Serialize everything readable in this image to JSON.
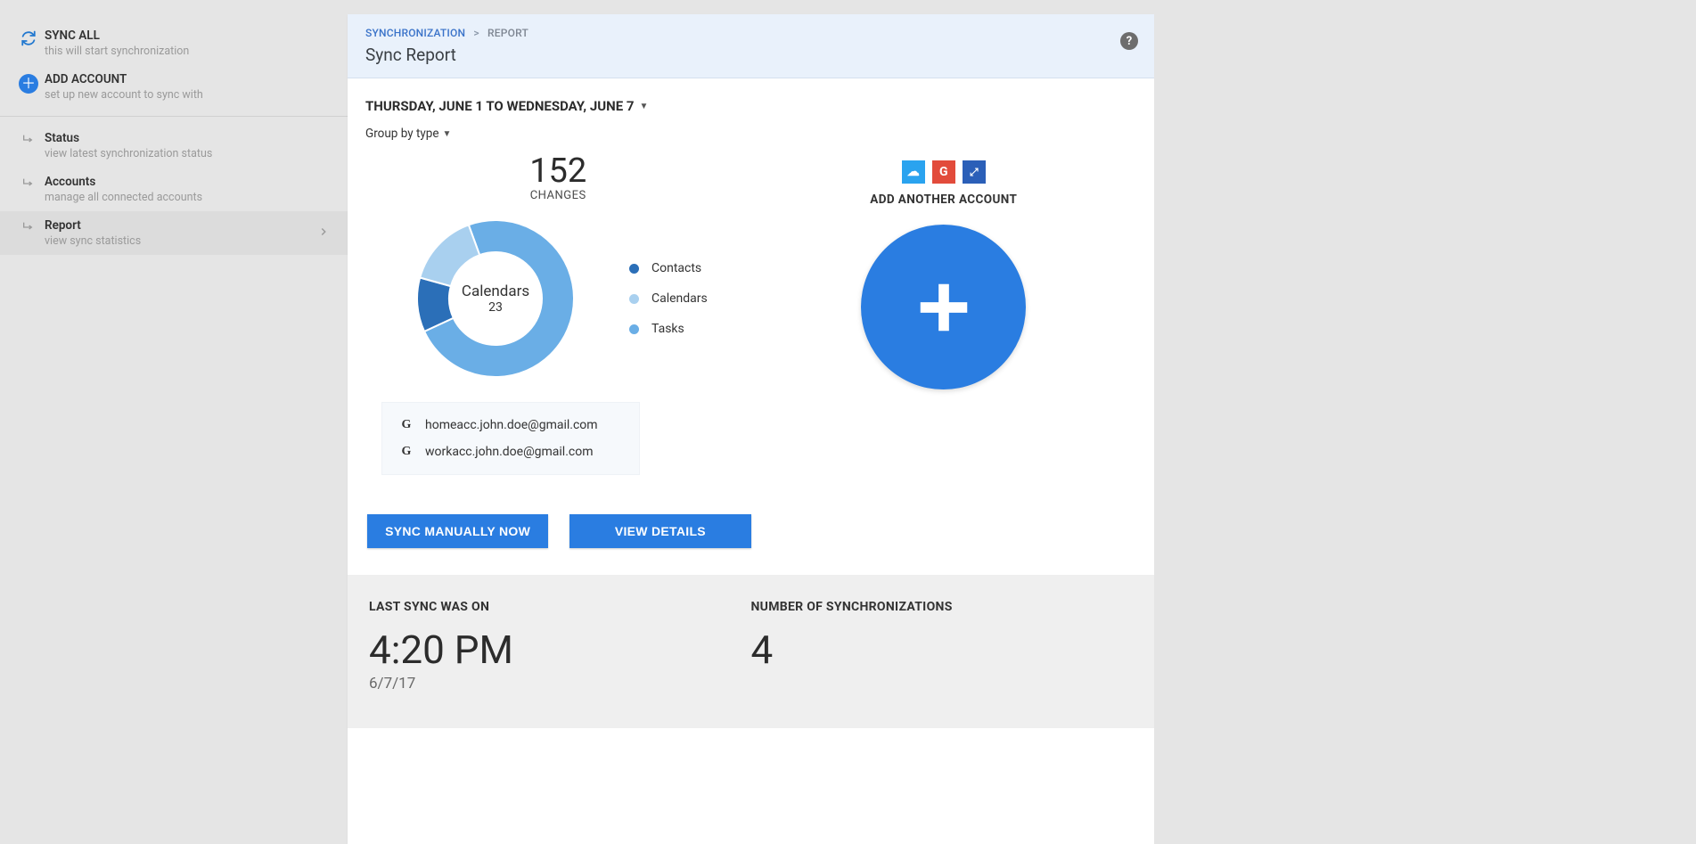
{
  "sidebar": {
    "sync_all": {
      "title": "SYNC ALL",
      "subtitle": "this will start synchronization"
    },
    "add_account": {
      "title": "ADD ACCOUNT",
      "subtitle": "set up new account to sync with"
    },
    "status": {
      "title": "Status",
      "subtitle": "view latest synchronization status"
    },
    "accounts": {
      "title": "Accounts",
      "subtitle": "manage all connected accounts"
    },
    "report": {
      "title": "Report",
      "subtitle": "view sync statistics"
    }
  },
  "header": {
    "breadcrumb_root": "SYNCHRONIZATION",
    "breadcrumb_sep": ">",
    "breadcrumb_current": "REPORT",
    "title": "Sync Report",
    "help": "?"
  },
  "filters": {
    "date_range": "THURSDAY, JUNE 1 TO WEDNESDAY, JUNE 7",
    "group_by": "Group by type"
  },
  "chart_data": {
    "type": "pie",
    "total": 152,
    "total_label": "CHANGES",
    "center_label": "Calendars",
    "center_value": "23",
    "series": [
      {
        "name": "Tasks",
        "value": 112,
        "color": "#6aaee6"
      },
      {
        "name": "Contacts",
        "value": 17,
        "color": "#2b6fb8"
      },
      {
        "name": "Calendars",
        "value": 23,
        "color": "#a9d0ef"
      }
    ],
    "legend": [
      {
        "name": "Contacts",
        "color": "#2b6fb8"
      },
      {
        "name": "Calendars",
        "color": "#a9d0ef"
      },
      {
        "name": "Tasks",
        "color": "#6aaee6"
      }
    ]
  },
  "accounts": [
    {
      "provider": "G",
      "email": "homeacc.john.doe@gmail.com"
    },
    {
      "provider": "G",
      "email": "workacc.john.doe@gmail.com"
    }
  ],
  "buttons": {
    "sync_now": "SYNC MANUALLY NOW",
    "view_details": "VIEW DETAILS"
  },
  "add_panel": {
    "label": "ADD ANOTHER ACCOUNT",
    "providers": {
      "cloud": "☁",
      "google": "G",
      "expand": "⤢"
    }
  },
  "stats": {
    "last_sync_label": "LAST SYNC WAS ON",
    "last_sync_time": "4:20 PM",
    "last_sync_date": "6/7/17",
    "num_sync_label": "NUMBER OF SYNCHRONIZATIONS",
    "num_sync_value": "4"
  }
}
